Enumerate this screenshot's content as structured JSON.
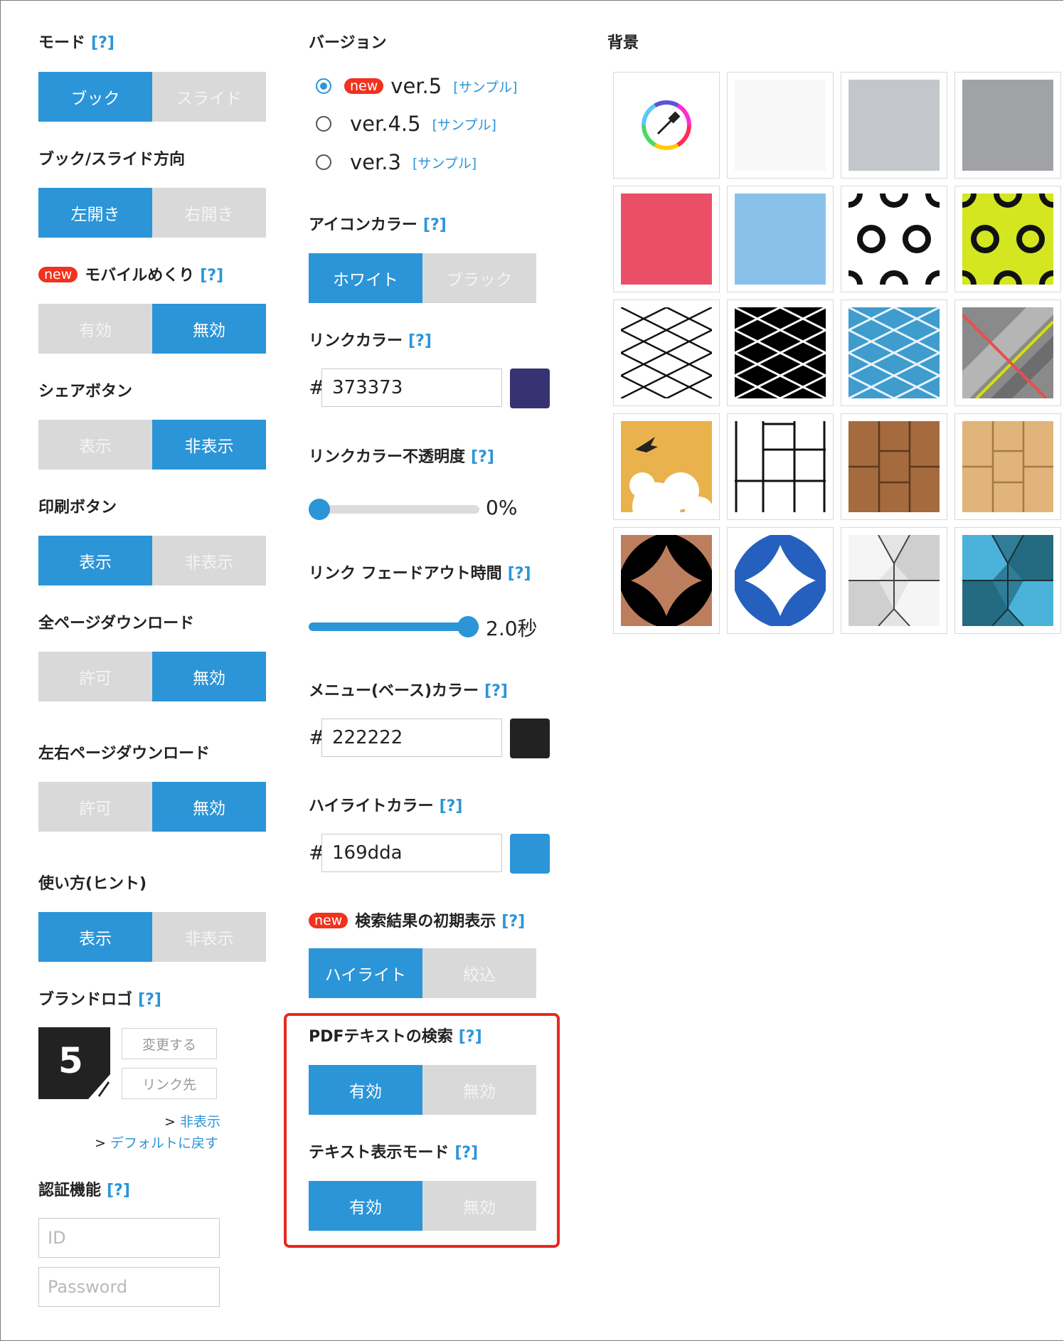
{
  "left": {
    "mode": {
      "label": "モード",
      "help": "[?]",
      "options": [
        "ブック",
        "スライド"
      ],
      "selected": 0
    },
    "direction": {
      "label": "ブック/スライド方向",
      "options": [
        "左開き",
        "右開き"
      ],
      "selected": 0
    },
    "mobile_flip": {
      "badge": "new",
      "label": "モバイルめくり",
      "help": "[?]",
      "options": [
        "有効",
        "無効"
      ],
      "selected": 1
    },
    "share_button": {
      "label": "シェアボタン",
      "options": [
        "表示",
        "非表示"
      ],
      "selected": 1
    },
    "print_button": {
      "label": "印刷ボタン",
      "options": [
        "表示",
        "非表示"
      ],
      "selected": 0
    },
    "all_download": {
      "label": "全ページダウンロード",
      "options": [
        "許可",
        "無効"
      ],
      "selected": 1
    },
    "lr_download": {
      "label": "左右ページダウンロード",
      "options": [
        "許可",
        "無効"
      ],
      "selected": 1
    },
    "usage_hint": {
      "label": "使い方(ヒント)",
      "options": [
        "表示",
        "非表示"
      ],
      "selected": 0
    },
    "brand_logo": {
      "label": "ブランドロゴ",
      "help": "[?]",
      "logo_text": "5",
      "change_button": "変更する",
      "link_button": "リンク先",
      "hide_prefix": "> ",
      "hide_link": "非表示",
      "default_prefix": "> ",
      "default_link": "デフォルトに戻す"
    },
    "auth": {
      "label": "認証機能",
      "help": "[?]",
      "id_placeholder": "ID",
      "password_placeholder": "Password"
    }
  },
  "middle": {
    "version": {
      "label": "バージョン",
      "items": [
        {
          "badge": "new",
          "name": "ver.5",
          "sample": "[サンプル]",
          "selected": true
        },
        {
          "badge": "",
          "name": "ver.4.5",
          "sample": "[サンプル]",
          "selected": false
        },
        {
          "badge": "",
          "name": "ver.3",
          "sample": "[サンプル]",
          "selected": false
        }
      ]
    },
    "icon_color": {
      "label": "アイコンカラー",
      "help": "[?]",
      "options": [
        "ホワイト",
        "ブラック"
      ],
      "selected": 0
    },
    "link_color": {
      "label": "リンクカラー",
      "help": "[?]",
      "hash": "#",
      "value": "373373",
      "swatch": "#373373"
    },
    "link_opacity": {
      "label": "リンクカラー不透明度",
      "help": "[?]",
      "value": 0,
      "value_text": "0%"
    },
    "link_fade": {
      "label": "リンク フェードアウト時間",
      "help": "[?]",
      "value": 1.0,
      "value_text": "2.0秒"
    },
    "menu_color": {
      "label": "メニュー(ベース)カラー",
      "help": "[?]",
      "hash": "#",
      "value": "222222",
      "swatch": "#222222"
    },
    "highlight_color": {
      "label": "ハイライトカラー",
      "help": "[?]",
      "hash": "#",
      "value": "169dda",
      "swatch": "#2b95d8"
    },
    "search_initial": {
      "badge": "new",
      "label": "検索結果の初期表示",
      "help": "[?]",
      "options": [
        "ハイライト",
        "絞込"
      ],
      "selected": 0
    },
    "pdf_text_search": {
      "label": "PDFテキストの検索",
      "help": "[?]",
      "options": [
        "有効",
        "無効"
      ],
      "selected": 0
    },
    "text_display_mode": {
      "label": "テキスト表示モード",
      "help": "[?]",
      "options": [
        "有効",
        "無効"
      ],
      "selected": 0
    },
    "highlight_box_color": "#e8291c"
  },
  "right": {
    "background": {
      "label": "背景",
      "tiles": [
        "color-picker-icon",
        "white-tile",
        "light-gray-tile",
        "gray-tile",
        "pink-tile",
        "light-blue-tile",
        "white-rings-pattern",
        "lime-rings-pattern",
        "white-lattice-pattern",
        "black-lattice-pattern",
        "blue-lattice-pattern",
        "gray-stripe-pattern",
        "bird-cloud-pattern",
        "white-brick-pattern",
        "dark-wood-pattern",
        "light-wood-pattern",
        "brown-quatrefoil-pattern",
        "blue-quatrefoil-pattern",
        "gray-cube-pattern",
        "teal-cube-pattern"
      ]
    }
  },
  "colors": {
    "accent": "#2b95d8",
    "inactive": "#d9d9d9",
    "help": "#2b95d8",
    "badge": "#f0321e"
  }
}
